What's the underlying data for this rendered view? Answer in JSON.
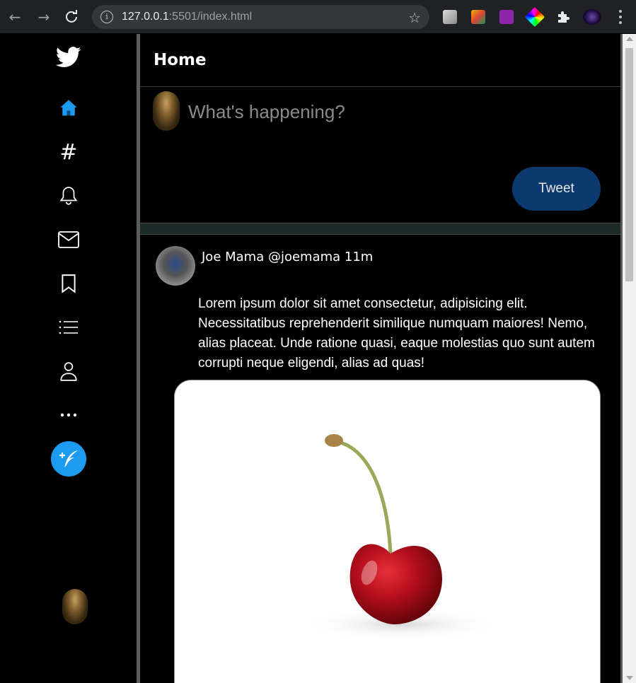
{
  "browser": {
    "url_host": "127.0.0.1",
    "url_path": ":5501/index.html"
  },
  "sidebar": {
    "items": [
      {
        "icon": "twitter-logo-icon"
      },
      {
        "icon": "home-icon"
      },
      {
        "icon": "hashtag-icon"
      },
      {
        "icon": "bell-icon"
      },
      {
        "icon": "mail-icon"
      },
      {
        "icon": "bookmark-icon"
      },
      {
        "icon": "list-icon"
      },
      {
        "icon": "profile-icon"
      },
      {
        "icon": "more-icon"
      },
      {
        "icon": "compose-tweet-icon"
      }
    ],
    "accent": "#1d9bf0"
  },
  "main": {
    "header_title": "Home",
    "compose": {
      "placeholder": "What's happening?",
      "tweet_button": "Tweet",
      "tweet_button_color": "#0d3a6e"
    },
    "post": {
      "meta": "Joe Mama @joemama 11m",
      "text": "Lorem ipsum dolor sit amet consectetur, adipisicing elit. Necessitatibus reprehenderit similique numquam maiores! Nemo, alias placeat. Unde ratione quasi, eaque molestias quo sunt autem corrupti neque eligendi, alias ad quas!",
      "image": "cherry"
    }
  }
}
